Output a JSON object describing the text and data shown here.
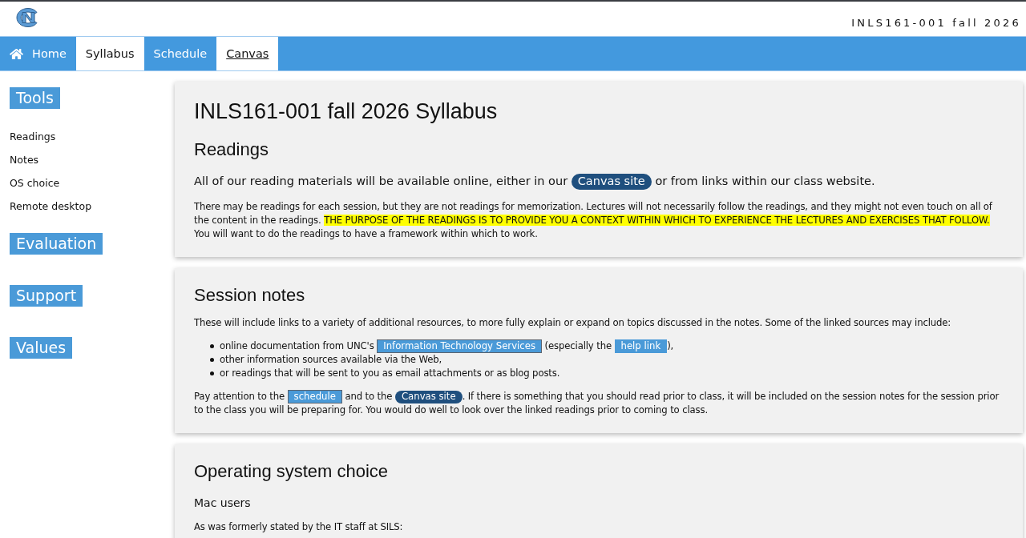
{
  "header": {
    "course_title": "INLS161-001 fall 2026"
  },
  "nav": {
    "tabs": [
      {
        "label": "Home",
        "kind": "home",
        "selected": false,
        "hovered": false
      },
      {
        "label": "Syllabus",
        "kind": "plain",
        "selected": true,
        "hovered": false
      },
      {
        "label": "Schedule",
        "kind": "plain",
        "selected": false,
        "hovered": false
      },
      {
        "label": "Canvas",
        "kind": "plain",
        "selected": false,
        "hovered": true
      }
    ]
  },
  "sidebar": {
    "groups": [
      {
        "heading": "Tools",
        "items": [
          "Readings",
          "Notes",
          "OS choice",
          "Remote desktop"
        ]
      },
      {
        "heading": "Evaluation"
      },
      {
        "heading": "Support"
      },
      {
        "heading": "Values"
      }
    ]
  },
  "cards": [
    {
      "title": "INLS161-001 fall 2026 Syllabus",
      "heading": "Readings",
      "blocks": [
        {
          "kind": "lead",
          "segments": [
            {
              "kind": "plain",
              "text": "All of our reading materials will be available online, either in our "
            },
            {
              "kind": "pill",
              "text": "Canvas site"
            },
            {
              "kind": "plain",
              "text": " or from links within our class website."
            }
          ]
        },
        {
          "kind": "paragraph",
          "segments": [
            {
              "kind": "plain",
              "text": "There may be readings for each session, but they are not readings for memorization. Lectures will not necessarily follow the readings, and they might not even touch on all of the content in the readings. "
            },
            {
              "kind": "marked",
              "text": "THE PURPOSE OF THE READINGS IS TO PROVIDE YOU A CONTEXT WITHIN WHICH TO EXPERIENCE THE LECTURES AND EXERCISES THAT FOLLOW."
            },
            {
              "kind": "plain",
              "text": " You will want to do the readings to have a framework within which to work."
            }
          ]
        }
      ]
    },
    {
      "heading": "Session notes",
      "blocks": [
        {
          "kind": "paragraph",
          "segments": [
            {
              "kind": "plain",
              "text": "These will include links to a variety of additional resources, to more fully explain or expand on topics discussed in the notes. Some of the linked sources may include:"
            }
          ]
        },
        {
          "kind": "bullets",
          "items": [
            {
              "segments": [
                {
                  "kind": "plain",
                  "text": "online documentation from UNC's "
                },
                {
                  "kind": "box",
                  "text": "Information Technology Services",
                  "outlined": true
                },
                {
                  "kind": "plain",
                  "text": " (especially the "
                },
                {
                  "kind": "box",
                  "text": "help link",
                  "outlined": false
                },
                {
                  "kind": "plain",
                  "text": "),"
                }
              ]
            },
            {
              "segments": [
                {
                  "kind": "plain",
                  "text": "other information sources available via the Web,"
                }
              ]
            },
            {
              "segments": [
                {
                  "kind": "plain",
                  "text": "or readings that will be sent to you as email attachments or as blog posts."
                }
              ]
            }
          ]
        },
        {
          "kind": "paragraph",
          "segments": [
            {
              "kind": "plain",
              "text": "Pay attention to the "
            },
            {
              "kind": "box",
              "text": "schedule",
              "outlined": true
            },
            {
              "kind": "plain",
              "text": " and to the "
            },
            {
              "kind": "pill",
              "text": "Canvas site"
            },
            {
              "kind": "plain",
              "text": ". If there is something that you should read prior to class, it will be included on the session notes for the session prior to the class you will be preparing for. You would do well to look over the linked readings prior to coming to class."
            }
          ]
        }
      ]
    },
    {
      "heading": "Operating system choice",
      "blocks": [
        {
          "kind": "subheading",
          "text": "Mac users"
        },
        {
          "kind": "paragraph",
          "segments": [
            {
              "kind": "plain",
              "text": "As was formerly stated by the IT staff at SILS:"
            }
          ]
        }
      ]
    }
  ]
}
